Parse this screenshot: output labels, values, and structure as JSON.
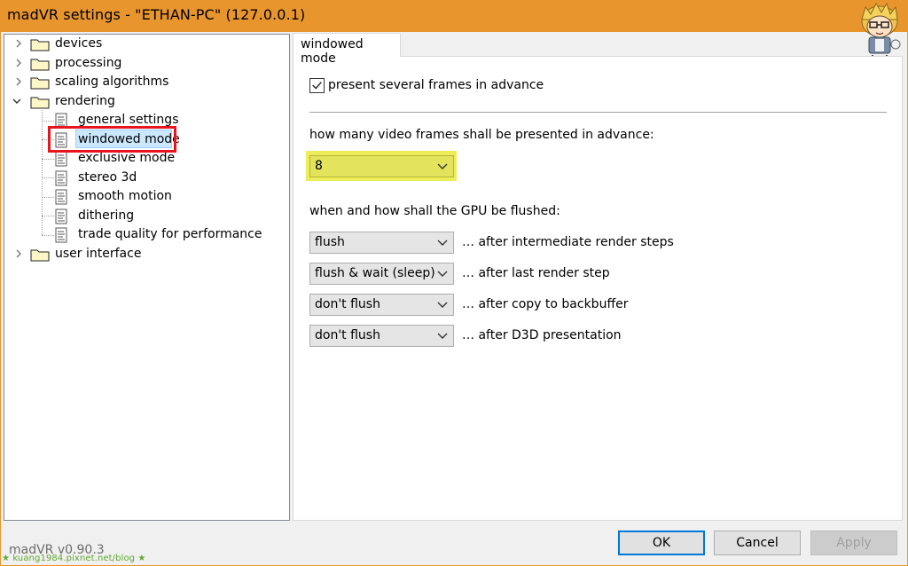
{
  "window": {
    "title": "madVR settings - \"ETHAN-PC\" (127.0.0.1)"
  },
  "tree": {
    "items": [
      {
        "label": "devices",
        "icon": "folder-icon",
        "expander": "chevron-right-icon"
      },
      {
        "label": "processing",
        "icon": "folder-icon",
        "expander": "chevron-right-icon"
      },
      {
        "label": "scaling algorithms",
        "icon": "folder-icon",
        "expander": "chevron-right-icon"
      },
      {
        "label": "rendering",
        "icon": "folder-icon",
        "expander": "chevron-down-icon",
        "children": [
          {
            "label": "general settings",
            "icon": "page-icon"
          },
          {
            "label": "windowed mode",
            "icon": "page-icon",
            "selected": true
          },
          {
            "label": "exclusive mode",
            "icon": "page-icon"
          },
          {
            "label": "stereo 3d",
            "icon": "page-icon"
          },
          {
            "label": "smooth motion",
            "icon": "page-icon"
          },
          {
            "label": "dithering",
            "icon": "page-icon"
          },
          {
            "label": "trade quality for performance",
            "icon": "page-icon"
          }
        ]
      },
      {
        "label": "user interface",
        "icon": "folder-icon",
        "expander": "chevron-right-icon"
      }
    ]
  },
  "version": "madVR v0.90.3",
  "watermark": "★ kuang1984.pixnet.net/blog ★",
  "tab": {
    "label": "windowed mode"
  },
  "settings": {
    "present_frames_label": "present several frames in advance",
    "present_frames_checked": true,
    "frames_question": "how many video frames shall be presented in advance:",
    "frames_value": "8",
    "flush_question": "when and how shall the GPU be flushed:",
    "flush_rows": [
      {
        "value": "flush",
        "label": "… after intermediate render steps"
      },
      {
        "value": "flush & wait (sleep)",
        "label": "… after last render step"
      },
      {
        "value": "don't flush",
        "label": "… after copy to backbuffer"
      },
      {
        "value": "don't flush",
        "label": "… after D3D presentation"
      }
    ]
  },
  "buttons": {
    "ok": "OK",
    "cancel": "Cancel",
    "apply": "Apply"
  },
  "colors": {
    "titlebar": "#e8952e",
    "highlight": "#eded5a",
    "red_annotation": "#e8151f",
    "ok_border": "#0078d7"
  }
}
